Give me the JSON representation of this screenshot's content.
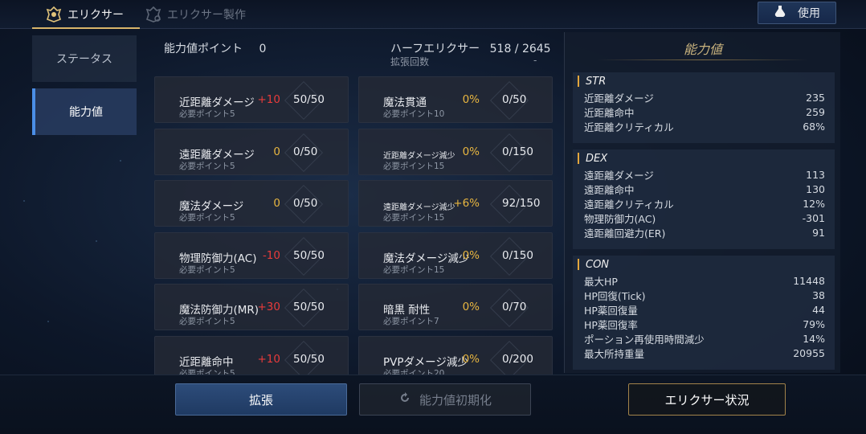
{
  "tabs": {
    "active": "エリクサー",
    "inactive": "エリクサー製作"
  },
  "use_button": "使用",
  "side": [
    "ステータス",
    "能力値"
  ],
  "header": {
    "points_label": "能力値ポイント",
    "points_value": "0",
    "half_label": "ハーフエリクサー",
    "half_value": "518 / 2645",
    "expand_label": "拡張回数",
    "expand_value": "-"
  },
  "left_cells": [
    {
      "name": "近距離ダメージ",
      "req": "必要ポイント5",
      "bonus": "+10",
      "count": "50/50"
    },
    {
      "name": "遠距離ダメージ",
      "req": "必要ポイント5",
      "bonus": "0",
      "count": "0/50"
    },
    {
      "name": "魔法ダメージ",
      "req": "必要ポイント5",
      "bonus": "0",
      "count": "0/50"
    },
    {
      "name": "物理防御力(AC)",
      "req": "必要ポイント5",
      "bonus": "-10",
      "count": "50/50"
    },
    {
      "name": "魔法防御力(MR)",
      "req": "必要ポイント5",
      "bonus": "+30",
      "count": "50/50"
    },
    {
      "name": "近距離命中",
      "req": "必要ポイント5",
      "bonus": "+10",
      "count": "50/50"
    }
  ],
  "right_cells": [
    {
      "name": "魔法貫通",
      "req": "必要ポイント10",
      "bonus": "0%",
      "count": "0/50"
    },
    {
      "name": "近距離ダメージ減少",
      "req": "必要ポイント15",
      "bonus": "0%",
      "count": "0/150"
    },
    {
      "name": "遠距離ダメージ減少",
      "req": "必要ポイント15",
      "bonus": "+6%",
      "count": "92/150"
    },
    {
      "name": "魔法ダメージ減少",
      "req": "必要ポイント15",
      "bonus": "0%",
      "count": "0/150"
    },
    {
      "name": "暗黒 耐性",
      "req": "必要ポイント7",
      "bonus": "0%",
      "count": "0/70"
    },
    {
      "name": "PVPダメージ減少",
      "req": "必要ポイント20",
      "bonus": "0%",
      "count": "0/200"
    }
  ],
  "panel": {
    "title": "能力値",
    "str": {
      "title": "STR",
      "rows": [
        [
          "近距離ダメージ",
          "235"
        ],
        [
          "近距離命中",
          "259"
        ],
        [
          "近距離クリティカル",
          "68%"
        ]
      ]
    },
    "dex": {
      "title": "DEX",
      "rows": [
        [
          "遠距離ダメージ",
          "113"
        ],
        [
          "遠距離命中",
          "130"
        ],
        [
          "遠距離クリティカル",
          "12%"
        ],
        [
          "物理防御力(AC)",
          "-301"
        ],
        [
          "遠距離回避力(ER)",
          "91"
        ]
      ]
    },
    "con": {
      "title": "CON",
      "rows": [
        [
          "最大HP",
          "11448"
        ],
        [
          "HP回復(Tick)",
          "38"
        ],
        [
          "HP薬回復量",
          "44"
        ],
        [
          "HP薬回復率",
          "79%"
        ],
        [
          "ポーション再使用時間減少",
          "14%"
        ],
        [
          "最大所持重量",
          "20955"
        ]
      ]
    }
  },
  "buttons": {
    "expand": "拡張",
    "reset": "能力値初期化",
    "status": "エリクサー状況"
  },
  "colors": {
    "accent": "#d8b46a",
    "bonus_positive": "#e83b3b",
    "bonus_zero": "#e8b640"
  }
}
